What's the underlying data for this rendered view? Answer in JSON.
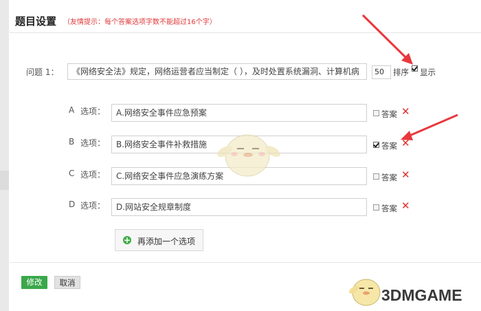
{
  "header": {
    "title": "题目设置",
    "hint": "（友情提示：每个答案选项字数不能超过16个字）"
  },
  "question": {
    "label": "问题 1：",
    "text": "《网络安全法》规定，网络运营者应当制定（ ），及时处置系统漏洞、计算机病",
    "order_value": "50",
    "order_label": "排序",
    "show_label": "显示",
    "show_checked": true
  },
  "options": [
    {
      "letter": "A",
      "label": "选项：",
      "value": "A.网络安全事件应急预案",
      "answer_label": "答案",
      "is_answer": false
    },
    {
      "letter": "B",
      "label": "选项：",
      "value": "B.网络安全事件补救措施",
      "answer_label": "答案",
      "is_answer": true
    },
    {
      "letter": "C",
      "label": "选项：",
      "value": "C.网络安全事件应急演练方案",
      "answer_label": "答案",
      "is_answer": false
    },
    {
      "letter": "D",
      "label": "选项：",
      "value": "D.网站安全规章制度",
      "answer_label": "答案",
      "is_answer": false
    }
  ],
  "add_option": {
    "label": "再添加一个选项",
    "icon": "plus-circle-icon"
  },
  "footer": {
    "save_label": "修改",
    "cancel_label": "取消"
  },
  "watermark": {
    "text": "3DMGAME"
  },
  "colors": {
    "hint_red": "#e03a3a",
    "delete_red": "#e03030",
    "save_green": "#3aa84a",
    "add_green": "#3fae49",
    "arrow_red": "#e8383d"
  }
}
